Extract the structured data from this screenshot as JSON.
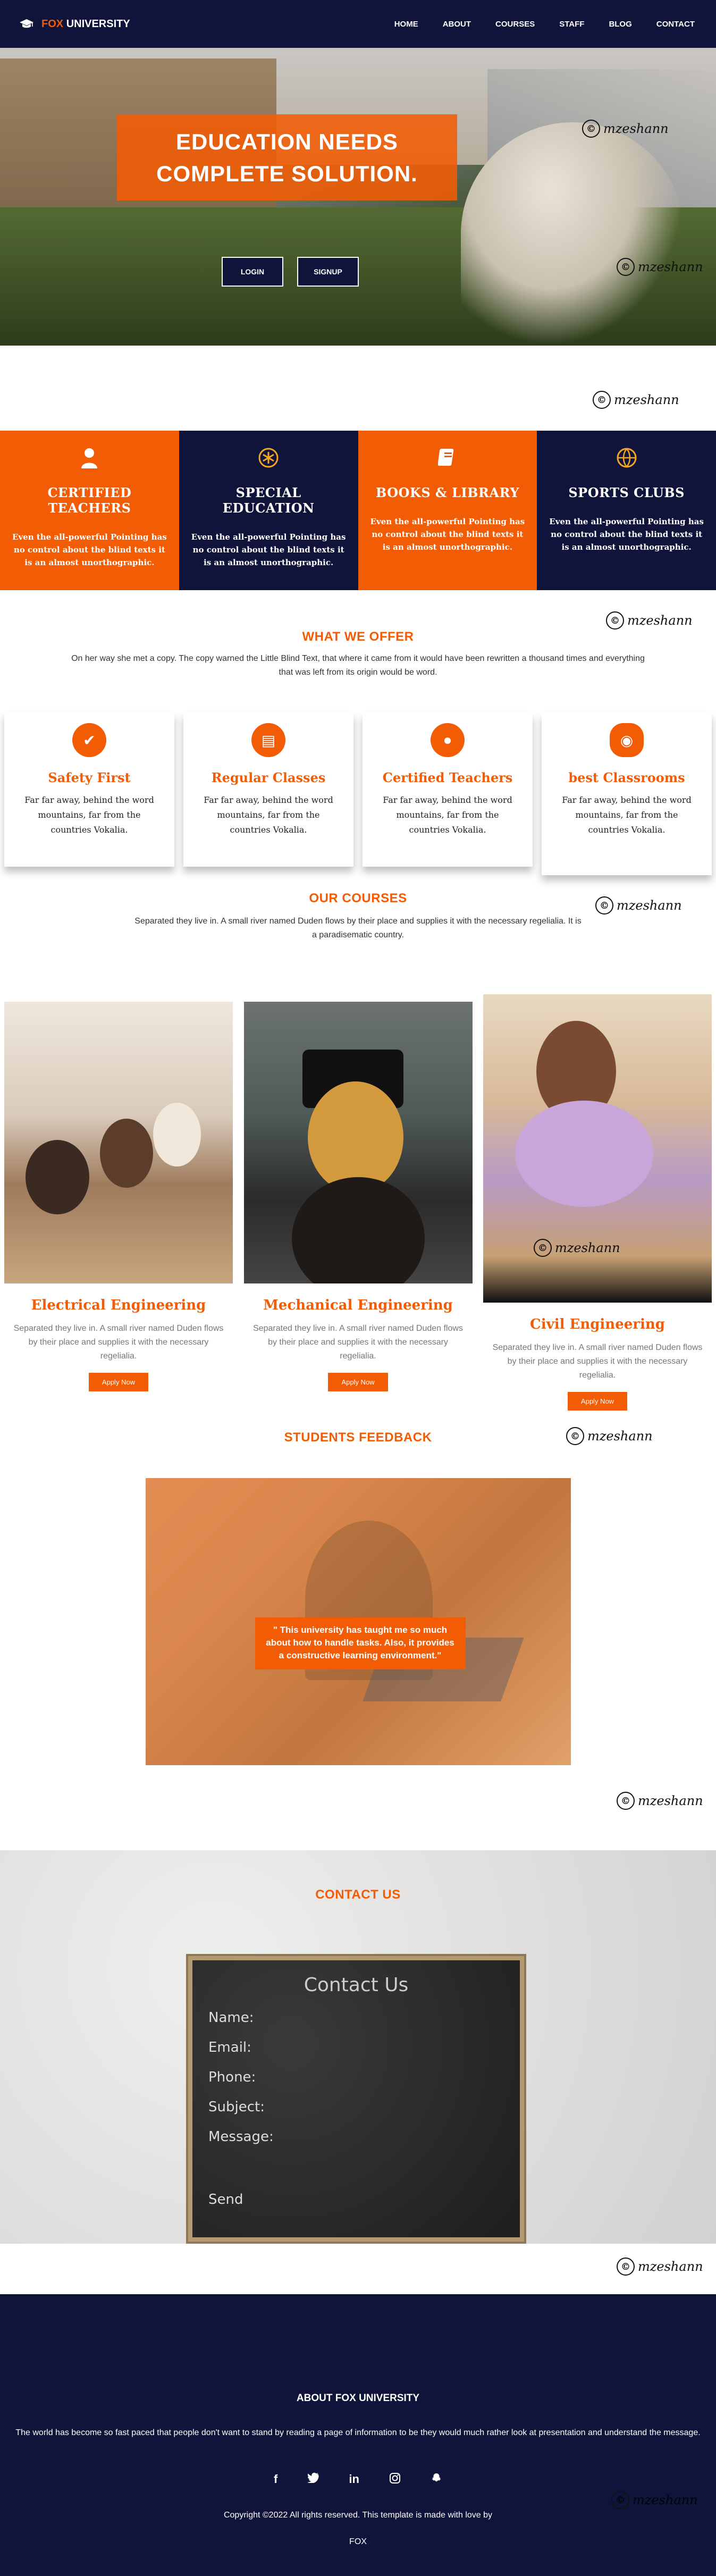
{
  "nav": {
    "brand_part1": "FOX",
    "brand_part2": "UNIVERSITY",
    "links": [
      "HOME",
      "ABOUT",
      "COURSES",
      "STAFF",
      "BLOG",
      "CONTACT"
    ]
  },
  "hero": {
    "title": "EDUCATION NEEDS COMPLETE SOLUTION.",
    "login_label": "LOGIN",
    "signup_label": "SIGNUP"
  },
  "watermark": {
    "symbol": "©",
    "text": "mzeshann"
  },
  "features": [
    {
      "title": "CERTIFIED TEACHERS",
      "text": "Even the all-powerful Pointing has no control about the blind texts it is an almost unorthographic.",
      "icon": "person-icon"
    },
    {
      "title": "SPECIAL EDUCATION",
      "text": "Even the all-powerful Pointing has no control about the blind texts it is an almost unorthographic.",
      "icon": "asterisk-icon"
    },
    {
      "title": "BOOKS & LIBRARY",
      "text": "Even the all-powerful Pointing has no control about the blind texts it is an almost unorthographic.",
      "icon": "book-icon"
    },
    {
      "title": "SPORTS CLUBS",
      "text": "Even the all-powerful Pointing has no control about the blind texts it is an almost unorthographic.",
      "icon": "ball-icon"
    }
  ],
  "offer": {
    "heading": "WHAT WE OFFER",
    "desc": "On her way she met a copy. The copy warned the Little Blind Text, that where it came from it would have been rewritten a thousand times and everything that was left from its origin would be word.",
    "cards": [
      {
        "title": "Safety First",
        "text": "Far far away, behind the word mountains, far from the countries Vokalia."
      },
      {
        "title": "Regular Classes",
        "text": "Far far away, behind the word mountains, far from the countries Vokalia."
      },
      {
        "title": "Certified Teachers",
        "text": "Far far away, behind the word mountains, far from the countries Vokalia."
      },
      {
        "title": "best Classrooms",
        "text": "Far far away, behind the word mountains, far from the countries Vokalia."
      }
    ]
  },
  "courses": {
    "heading": "OUR COURSES",
    "desc": "Separated they live in. A small river named Duden flows by their place and supplies it with the necessary regelialia. It is a paradisematic country.",
    "items": [
      {
        "title": "Electrical Engineering",
        "text": "Separated they live in. A small river named Duden flows by their place and supplies it with the necessary regelialia.",
        "button": "Apply Now"
      },
      {
        "title": "Mechanical Engineering",
        "text": "Separated they live in. A small river named Duden flows by their place and supplies it with the necessary regelialia.",
        "button": "Apply Now"
      },
      {
        "title": "Civil Engineering",
        "text": "Separated they live in. A small river named Duden flows by their place and supplies it with the necessary regelialia.",
        "button": "Apply Now"
      }
    ]
  },
  "feedback": {
    "heading": "STUDENTS FEEDBACK",
    "quote": "\" This university has taught me so much about how to handle tasks. Also, it provides a constructive learning environment.\""
  },
  "contact": {
    "heading": "CONTACT US",
    "board_title": "Contact Us",
    "fields": [
      "Name:",
      "Email:",
      "Phone:",
      "Subject:",
      "Message:"
    ],
    "send": "Send"
  },
  "footer": {
    "heading": "ABOUT FOX UNIVERSITY",
    "about": "The world has become so fast paced that people don't want to stand by reading a page of information to be they would much rather look at presentation and understand the message.",
    "socials": [
      "facebook-icon",
      "twitter-icon",
      "linkedin-icon",
      "instagram-icon",
      "snapchat-icon"
    ],
    "copyright": "Copyright ©2022 All rights reserved. This template is made with love by",
    "brand": "FOX"
  },
  "colors": {
    "accent": "#f25c05",
    "navy": "#11143a"
  }
}
